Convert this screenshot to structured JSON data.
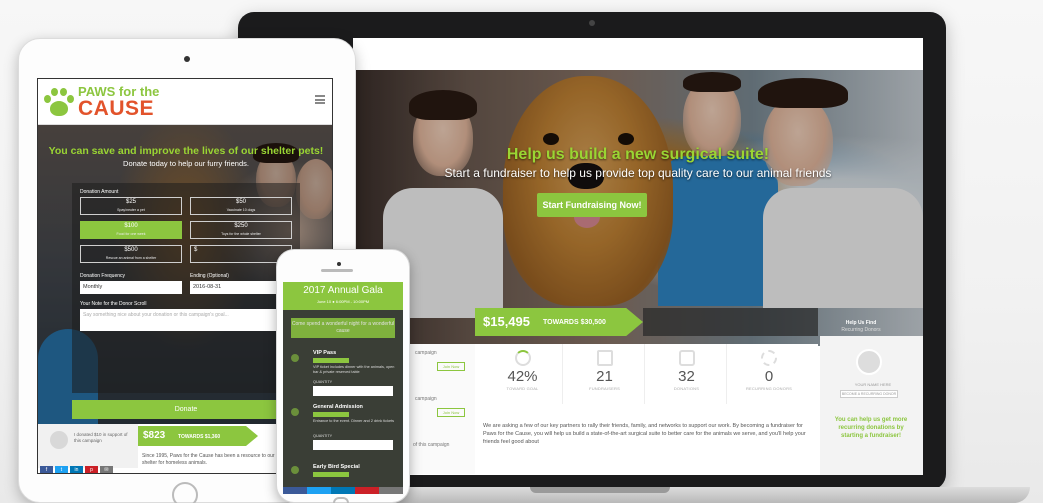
{
  "laptop": {
    "hero_title": "Help us build a new surgical suite!",
    "hero_subtitle": "Start a fundraiser to help us provide top quality care to our animal friends",
    "cta_button": "Start Fundraising Now!",
    "raised_amount": "$15,495",
    "raised_towards": "TOWARDS $30,500",
    "help_first": "Help Us Find",
    "help_first_sub": "Recurring Donors",
    "stats": [
      {
        "value": "42%",
        "label": "TOWARD GOAL"
      },
      {
        "value": "21",
        "label": "FUNDRAISERS"
      },
      {
        "value": "32",
        "label": "DONATIONS"
      },
      {
        "value": "0",
        "label": "RECURRING DONORS"
      }
    ],
    "left_links": [
      "campaign",
      "campaign",
      "of this campaign"
    ],
    "left_button": "Join Now",
    "body_text": "We are asking a few of our key partners to rally their friends, family, and networks to support our work. By becoming a fundraiser for Paws for the Cause, you will help us build a state-of-the-art surgical suite to better care for the animals we serve, and you'll help your friends feel good about",
    "side_name": "YOUR NAME HERE",
    "side_button": "BECOME A RECURRING DONOR",
    "side_cta": "You can help us get more recurring donations by starting a fundraiser!"
  },
  "tablet": {
    "logo_top": "PAWS for the",
    "logo_bottom": "CAUSE",
    "headline": "You can save and improve the lives of our shelter pets!",
    "subheadline": "Donate today to help our furry friends.",
    "donation_amount_label": "Donation Amount",
    "amounts": [
      {
        "amount": "$25",
        "desc": "Spay/neuter a pet",
        "selected": false
      },
      {
        "amount": "$50",
        "desc": "Vaccinate 10 dogs",
        "selected": false
      },
      {
        "amount": "$100",
        "desc": "Food for one week",
        "selected": true
      },
      {
        "amount": "$250",
        "desc": "Toys for the whole shelter",
        "selected": false
      },
      {
        "amount": "$500",
        "desc": "Rescue an animal from a shelter",
        "selected": false
      },
      {
        "amount": "$",
        "desc": "",
        "selected": false
      }
    ],
    "frequency_label": "Donation Frequency",
    "frequency_value": "Monthly",
    "ending_label": "Ending (Optional)",
    "ending_value": "2016-08-31",
    "note_label": "Your Note for the Donor Scroll",
    "note_placeholder": "Say something nice about your donation or this campaign's goal...",
    "donate_button": "Donate",
    "supporter_text": "I donated $10 in support of this campaign",
    "goal_amount": "$823",
    "goal_towards": "TOWARDS $1,360",
    "since_text": "Since 1995, Paws for the Cause has been a resource to our community and a shelter for homeless animals.",
    "social": [
      "f",
      "t",
      "in",
      "p",
      "✉"
    ]
  },
  "phone": {
    "title": "2017 Annual Gala",
    "date": "June 10 ● 6:00PM - 10:00PM",
    "banner": "Come spend a wonderful night for a wonderful cause",
    "items": [
      {
        "title": "VIP Pass",
        "desc": "VIP ticket includes dinner with the animals, open bar & private reserved table",
        "qty_label": "QUANTITY"
      },
      {
        "title": "General Admission",
        "desc": "Entrance to the event. Dinner and 2 drink tickets",
        "qty_label": "QUANTITY"
      },
      {
        "title": "Early Bird Special",
        "desc": "",
        "qty_label": ""
      }
    ]
  },
  "colors": {
    "brand_green": "#8cc63f",
    "brand_orange": "#e2532b"
  }
}
